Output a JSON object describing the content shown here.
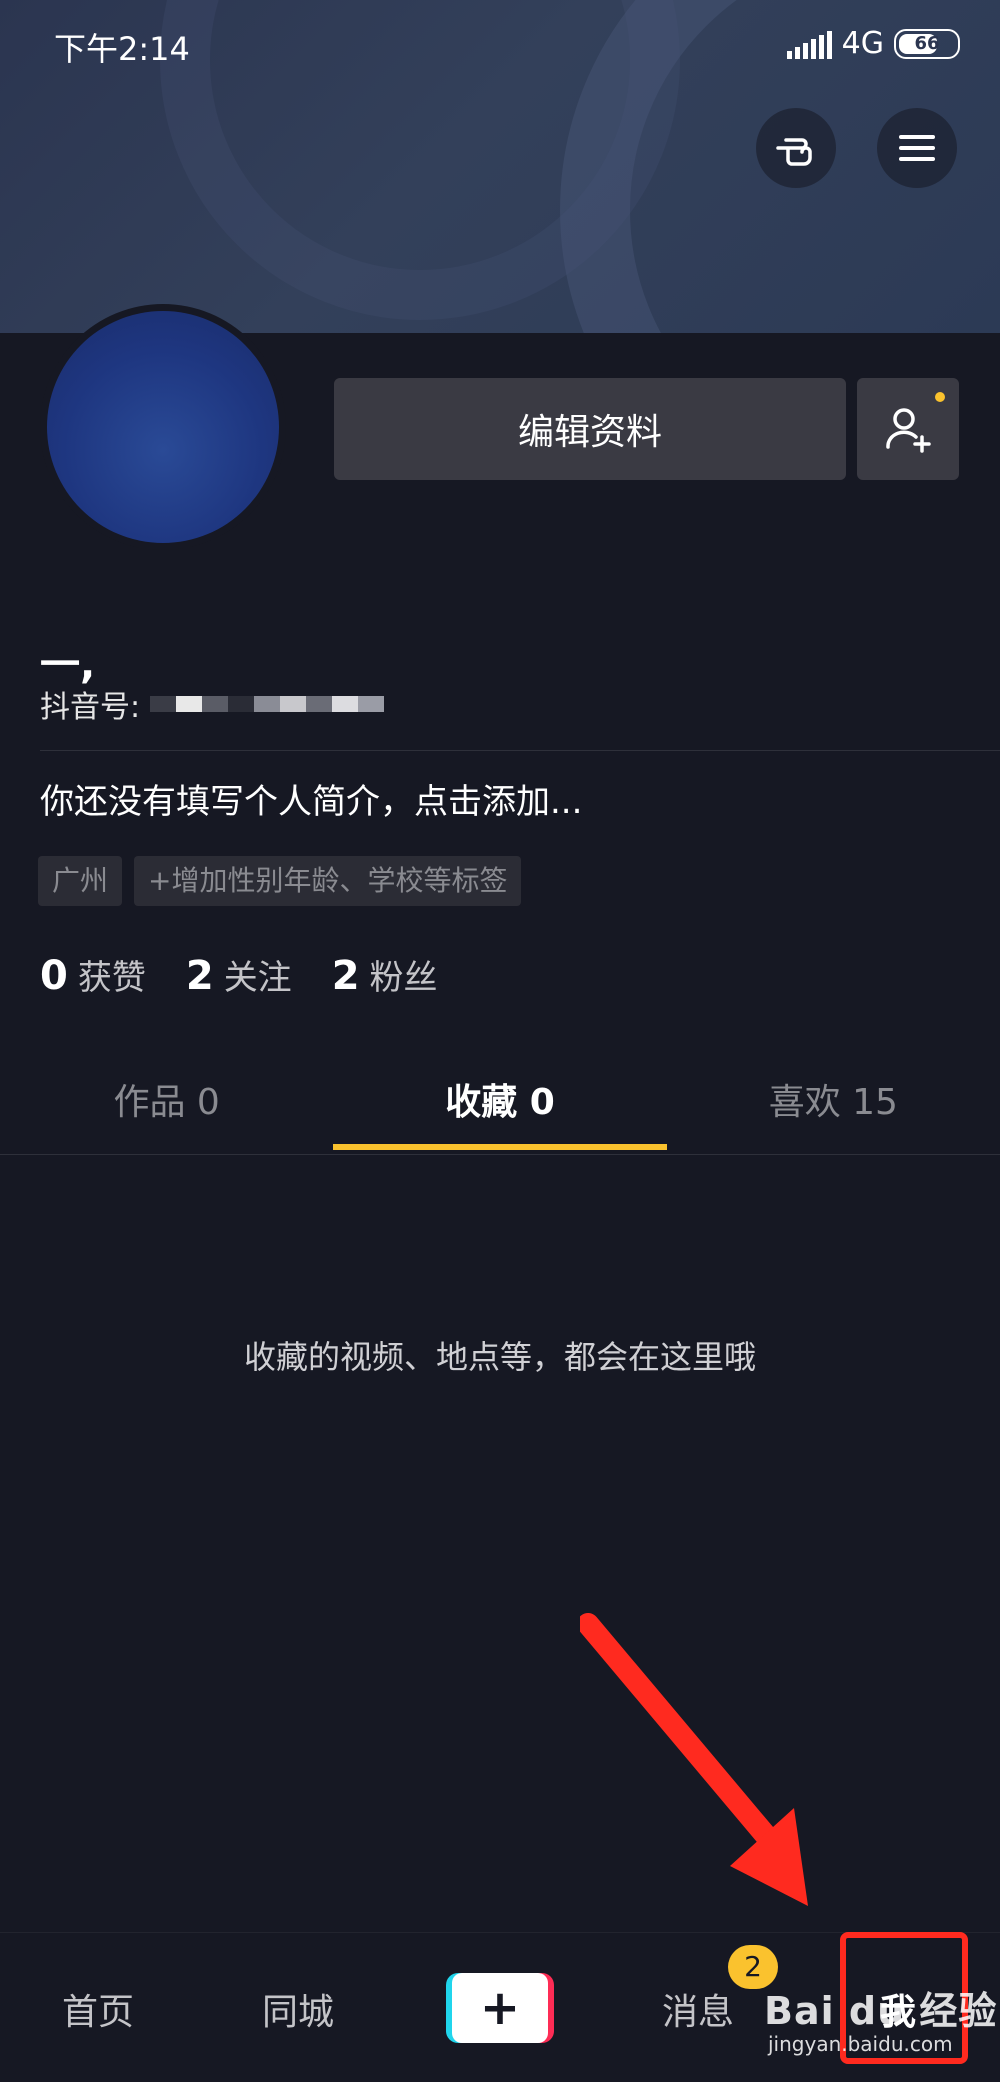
{
  "status_bar": {
    "time": "下午2:14",
    "network": "4G",
    "battery": "66"
  },
  "header": {
    "gesture_icon": "hand-pointing-icon",
    "menu_icon": "hamburger-menu-icon"
  },
  "profile": {
    "edit_button": "编辑资料",
    "nickname": "一,",
    "douyin_id_label": "抖音号:",
    "bio": "你还没有填写个人简介，点击添加...",
    "tags": [
      "广州",
      "+增加性别年龄、学校等标签"
    ],
    "stats": [
      {
        "num": "0",
        "label": "获赞"
      },
      {
        "num": "2",
        "label": "关注"
      },
      {
        "num": "2",
        "label": "粉丝"
      }
    ]
  },
  "tabs": [
    {
      "label": "作品 0",
      "active": false
    },
    {
      "label": "收藏 0",
      "active": true
    },
    {
      "label": "喜欢 15",
      "active": false
    }
  ],
  "empty_message": "收藏的视频、地点等，都会在这里哦",
  "bottom_nav": {
    "home": "首页",
    "nearby": "同城",
    "plus": "+",
    "messages": "消息",
    "messages_badge": "2",
    "me": "我"
  },
  "watermark": {
    "brand": "Bai du 经验",
    "url": "jingyan.baidu.com"
  },
  "colors": {
    "background": "#161823",
    "accent": "#fac22e",
    "annotation": "#ff2a1f"
  }
}
